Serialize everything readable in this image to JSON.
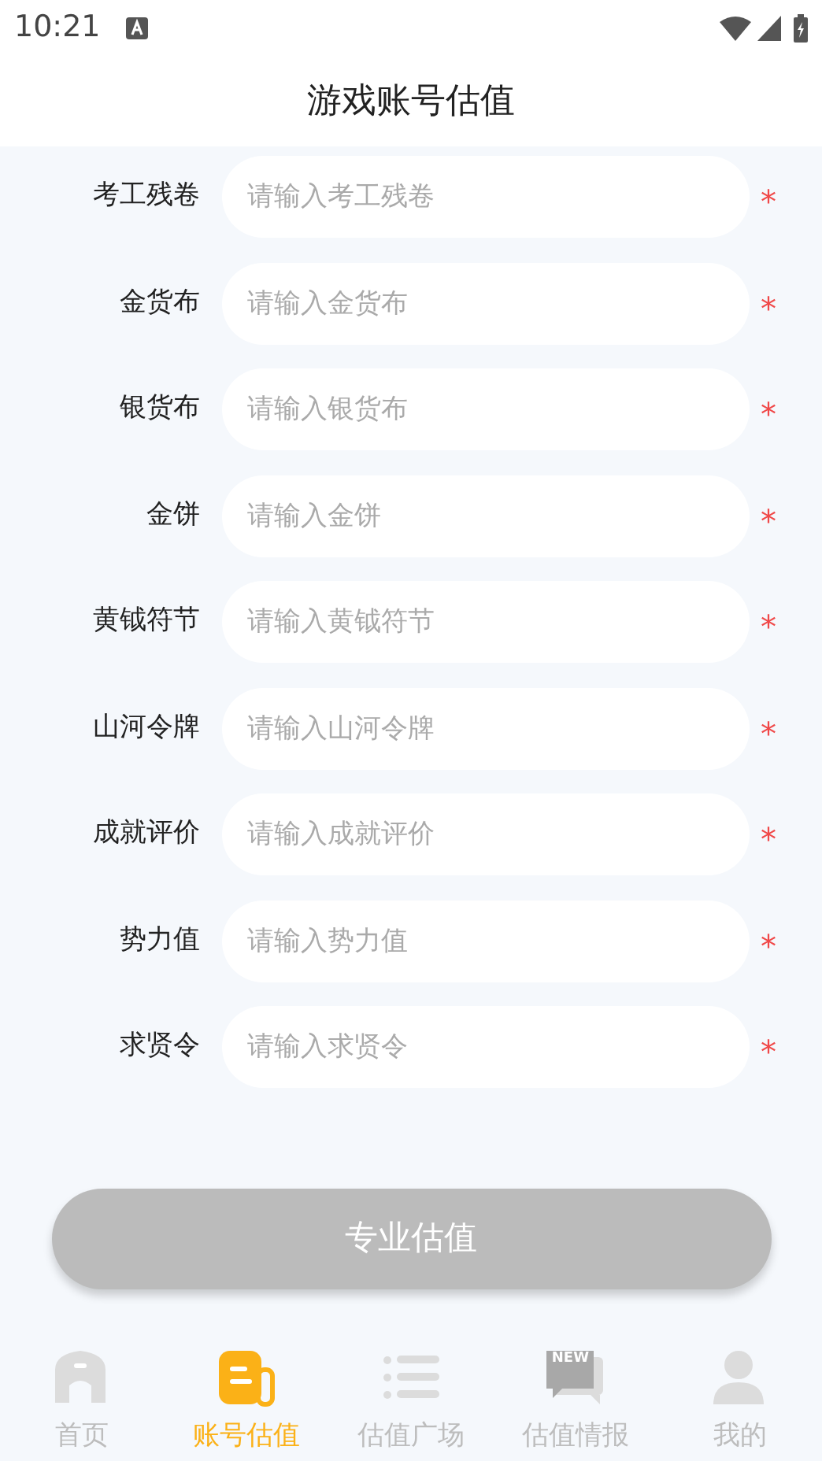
{
  "status_bar": {
    "time": "10:21"
  },
  "header": {
    "title": "游戏账号估值"
  },
  "fields": [
    {
      "label": "考工残卷",
      "placeholder": "请输入考工残卷",
      "required_mark": "*"
    },
    {
      "label": "金货布",
      "placeholder": "请输入金货布",
      "required_mark": "*"
    },
    {
      "label": "银货布",
      "placeholder": "请输入银货布",
      "required_mark": "*"
    },
    {
      "label": "金饼",
      "placeholder": "请输入金饼",
      "required_mark": "*"
    },
    {
      "label": "黄钺符节",
      "placeholder": "请输入黄钺符节",
      "required_mark": "*"
    },
    {
      "label": "山河令牌",
      "placeholder": "请输入山河令牌",
      "required_mark": "*"
    },
    {
      "label": "成就评价",
      "placeholder": "请输入成就评价",
      "required_mark": "*"
    },
    {
      "label": "势力值",
      "placeholder": "请输入势力值",
      "required_mark": "*"
    },
    {
      "label": "求贤令",
      "placeholder": "请输入求贤令",
      "required_mark": "*"
    }
  ],
  "submit_button": {
    "label": "专业估值",
    "disabled": true
  },
  "tab_bar": [
    {
      "label": "首页",
      "selected": false
    },
    {
      "label": "账号估值",
      "selected": true
    },
    {
      "label": "估值广场",
      "selected": false
    },
    {
      "label": "估值情报",
      "selected": false,
      "badge": "NEW"
    },
    {
      "label": "我的",
      "selected": false
    }
  ]
}
